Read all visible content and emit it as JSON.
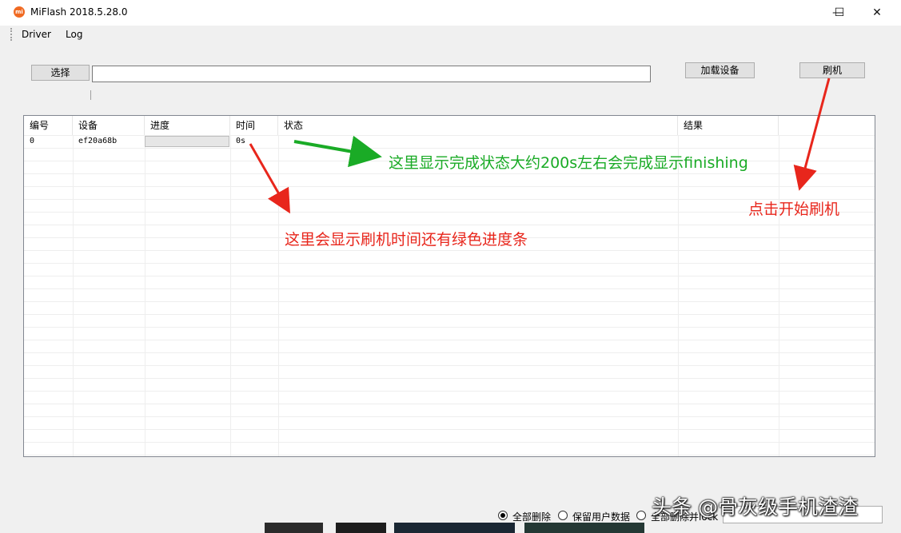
{
  "window": {
    "title": "MiFlash 2018.5.28.0",
    "icon_text": "mi",
    "minimize": "—",
    "maximize": "☐",
    "close": "✕"
  },
  "menu": {
    "items": [
      "Driver",
      "Log"
    ]
  },
  "toolbar": {
    "select_label": "选择",
    "path_value": "",
    "load_device_label": "加载设备",
    "flash_label": "刷机"
  },
  "table": {
    "columns": [
      "编号",
      "设备",
      "进度",
      "时间",
      "状态",
      "结果"
    ],
    "rows": [
      {
        "id": "0",
        "device": "ef20a68b",
        "progress": 0,
        "time": "0s",
        "status": "",
        "result": ""
      }
    ]
  },
  "annotations": {
    "status_note": "这里显示完成状态大约200s左右会完成显示finishing",
    "time_note": "这里会显示刷机时间还有绿色进度条",
    "flash_note": "点击开始刷机"
  },
  "options": {
    "radio": [
      {
        "label": "全部删除",
        "checked": true
      },
      {
        "label": "保留用户数据",
        "checked": false
      },
      {
        "label": "全部删除并lock",
        "checked": false
      }
    ]
  },
  "watermark": "头条 @骨灰级手机渣渣",
  "colors": {
    "annotation_red": "#e8261c",
    "annotation_green": "#1aab26",
    "progress_green": "#06b025"
  }
}
